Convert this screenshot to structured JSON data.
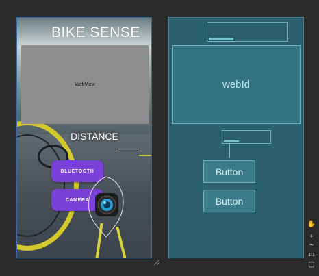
{
  "design": {
    "title": "BIKE SENSE",
    "webview_label": "WebView",
    "distance_label": "DISTANCE",
    "bluetooth_button": "BLUETOOTH",
    "camera_button": "CAMERA"
  },
  "blueprint": {
    "webview_id": "webId",
    "button1": "Button",
    "button2": "Button"
  },
  "tools": {
    "pan": "✋",
    "zoom_in": "+",
    "zoom_out": "−",
    "actual_size": "1:1",
    "fit": "▢"
  },
  "colors": {
    "background": "#2b2b2b",
    "blueprint": "#2b5f6e",
    "button_purple": "#7a40d8",
    "webview_gray": "#8e8e8e"
  }
}
